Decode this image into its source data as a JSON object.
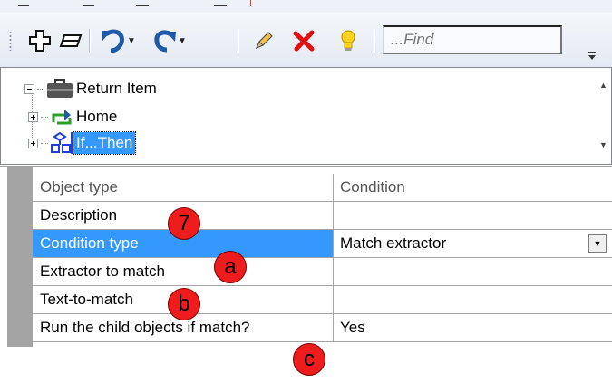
{
  "toolbar": {
    "find_placeholder": "...Find",
    "icons": [
      "add-icon",
      "remove-icon",
      "undo-icon",
      "redo-icon",
      "pencil-icon",
      "delete-icon",
      "lightbulb-icon"
    ]
  },
  "tree": {
    "items": [
      {
        "label": "Return Item",
        "icon": "briefcase-icon",
        "expanded": true
      },
      {
        "label": "Home",
        "icon": "loop-icon",
        "expanded": false
      },
      {
        "label": "If...Then",
        "icon": "condition-icon",
        "expanded": false,
        "selected": true
      }
    ]
  },
  "grid": {
    "header": {
      "name": "Object type",
      "value": "Condition"
    },
    "rows": [
      {
        "name": "Description",
        "value": ""
      },
      {
        "name": "Condition type",
        "value": "Match extractor",
        "selected": true
      },
      {
        "name": "Extractor to match",
        "value": ""
      },
      {
        "name": "Text-to-match",
        "value": ""
      },
      {
        "name": "Run the child objects if match?",
        "value": "Yes"
      }
    ]
  },
  "markers": [
    "7",
    "a",
    "b",
    "c"
  ],
  "colors": {
    "selection": "#3399ff",
    "marker": "#ee1c1c",
    "undo": "#1e5aa8",
    "delete": "#e01010"
  }
}
